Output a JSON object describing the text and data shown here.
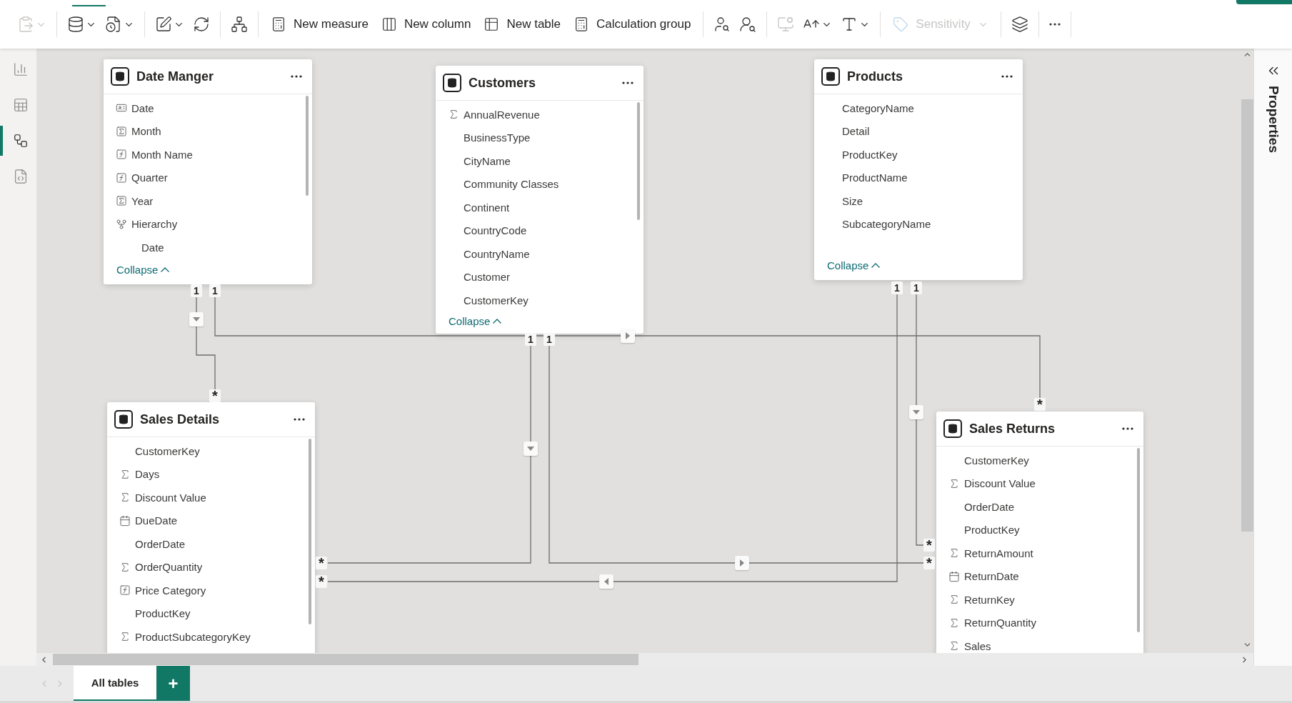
{
  "ribbon": {
    "tab_indicator": true
  },
  "toolbar": [
    {
      "kind": "icon",
      "dropdown": true,
      "disabled": true
    },
    {
      "kind": "separator"
    },
    {
      "kind": "icon",
      "dropdown": true,
      "disabled": false
    },
    {
      "kind": "icon",
      "dropdown": true,
      "disabled": false
    },
    {
      "kind": "separator"
    },
    {
      "kind": "icon",
      "dropdown": true,
      "disabled": false
    },
    {
      "kind": "icon",
      "dropdown": false,
      "disabled": false
    },
    {
      "kind": "separator"
    },
    {
      "kind": "icon",
      "dropdown": false,
      "disabled": false
    },
    {
      "kind": "separator"
    },
    {
      "kind": "button",
      "label": "New measure",
      "dropdown": false,
      "disabled": false
    },
    {
      "kind": "button",
      "label": "New column",
      "dropdown": false,
      "disabled": false
    },
    {
      "kind": "button",
      "label": "New table",
      "dropdown": false,
      "disabled": false
    },
    {
      "kind": "button",
      "label": "Calculation group",
      "dropdown": false,
      "disabled": false
    },
    {
      "kind": "separator"
    },
    {
      "kind": "icon",
      "dropdown": false,
      "disabled": false
    },
    {
      "kind": "icon",
      "dropdown": false,
      "disabled": false
    },
    {
      "kind": "separator"
    },
    {
      "kind": "icon",
      "dropdown": false,
      "disabled": true
    },
    {
      "kind": "icon",
      "dropdown": true,
      "disabled": false
    },
    {
      "kind": "icon",
      "dropdown": true,
      "disabled": false
    },
    {
      "kind": "separator"
    },
    {
      "kind": "button",
      "label": "Sensitivity",
      "dropdown": true,
      "disabled": true
    },
    {
      "kind": "separator"
    },
    {
      "kind": "icon",
      "dropdown": false,
      "disabled": false
    },
    {
      "kind": "separator"
    },
    {
      "kind": "icon",
      "dropdown": false,
      "disabled": false
    },
    {
      "kind": "separator"
    }
  ],
  "sidebar": {
    "items": [
      {
        "kind": "report",
        "selected": false
      },
      {
        "kind": "table",
        "selected": false
      },
      {
        "kind": "model",
        "selected": true
      },
      {
        "kind": "dax",
        "selected": false
      }
    ]
  },
  "tables": [
    {
      "title": "Date Manger",
      "scrollbar": true,
      "collapse_label": "Collapse",
      "fields": [
        {
          "name": "Date",
          "kind": "date_key"
        },
        {
          "name": "Month",
          "kind": "calc_table"
        },
        {
          "name": "Month Name",
          "kind": "calculated"
        },
        {
          "name": "Quarter",
          "kind": "calculated"
        },
        {
          "name": "Year",
          "kind": "calc_table"
        },
        {
          "name": "Hierarchy",
          "kind": "hierarchy",
          "children": [
            {
              "name": "Date",
              "kind": "plain"
            }
          ]
        }
      ]
    },
    {
      "title": "Customers",
      "scrollbar": true,
      "collapse_label": "Collapse",
      "fields": [
        {
          "name": "AnnualRevenue",
          "kind": "sum"
        },
        {
          "name": "BusinessType",
          "kind": "plain"
        },
        {
          "name": "CityName",
          "kind": "plain"
        },
        {
          "name": "Community Classes",
          "kind": "plain"
        },
        {
          "name": "Continent",
          "kind": "plain"
        },
        {
          "name": "CountryCode",
          "kind": "plain"
        },
        {
          "name": "CountryName",
          "kind": "plain"
        },
        {
          "name": "Customer",
          "kind": "plain"
        },
        {
          "name": "CustomerKey",
          "kind": "plain"
        }
      ]
    },
    {
      "title": "Products",
      "scrollbar": false,
      "collapse_label": "Collapse",
      "fields": [
        {
          "name": "CategoryName",
          "kind": "plain"
        },
        {
          "name": "Detail",
          "kind": "plain"
        },
        {
          "name": "ProductKey",
          "kind": "plain"
        },
        {
          "name": "ProductName",
          "kind": "plain"
        },
        {
          "name": "Size",
          "kind": "plain"
        },
        {
          "name": "SubcategoryName",
          "kind": "plain"
        }
      ]
    },
    {
      "title": "Sales Details",
      "scrollbar": true,
      "fields": [
        {
          "name": "CustomerKey",
          "kind": "plain"
        },
        {
          "name": "Days",
          "kind": "sum"
        },
        {
          "name": "Discount Value",
          "kind": "sum"
        },
        {
          "name": "DueDate",
          "kind": "date"
        },
        {
          "name": "OrderDate",
          "kind": "plain"
        },
        {
          "name": "OrderQuantity",
          "kind": "sum"
        },
        {
          "name": "Price Category",
          "kind": "calculated"
        },
        {
          "name": "ProductKey",
          "kind": "plain"
        },
        {
          "name": "ProductSubcategoryKey",
          "kind": "sum"
        }
      ]
    },
    {
      "title": "Sales Returns",
      "scrollbar": true,
      "fields": [
        {
          "name": "CustomerKey",
          "kind": "plain"
        },
        {
          "name": "Discount Value",
          "kind": "sum"
        },
        {
          "name": "OrderDate",
          "kind": "plain"
        },
        {
          "name": "ProductKey",
          "kind": "plain"
        },
        {
          "name": "ReturnAmount",
          "kind": "sum"
        },
        {
          "name": "ReturnDate",
          "kind": "date"
        },
        {
          "name": "ReturnKey",
          "kind": "sum"
        },
        {
          "name": "ReturnQuantity",
          "kind": "sum"
        },
        {
          "name": "Sales",
          "kind": "sum"
        }
      ]
    }
  ],
  "relationships": [
    {
      "from_label": "1",
      "to_label": "*"
    },
    {
      "from_label": "1",
      "to_label": "*"
    },
    {
      "from_label": "1",
      "to_label": "*"
    },
    {
      "from_label": "1",
      "to_label": "*"
    },
    {
      "from_label": "1",
      "to_label": "*"
    },
    {
      "from_label": "1",
      "to_label": "*"
    }
  ],
  "properties_panel": {
    "title": "Properties"
  },
  "page_tabs": [
    {
      "label": "All tables",
      "selected": true
    }
  ],
  "add_page_button": "+"
}
